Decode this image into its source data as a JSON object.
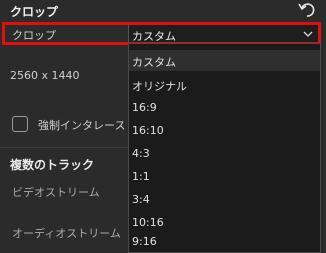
{
  "panel_title": "クロップ",
  "icons": {
    "undo": "undo-icon",
    "chevron": "chevron-down-icon"
  },
  "crop": {
    "label": "クロップ",
    "selected": "カスタム",
    "options": [
      "カスタム",
      "オリジナル",
      "16:9",
      "16:10",
      "4:3",
      "1:1",
      "3:4",
      "10:16",
      "9:16"
    ]
  },
  "resolution": "2560 x 1440",
  "deinterlace_label": "強制インタレース",
  "multi_track": {
    "title": "複数のトラック",
    "video_label": "ビデオストリーム",
    "audio_label": "オーディオストリーム"
  },
  "colors": {
    "highlight": "#e01010",
    "background": "#2b2b2b",
    "dropdown": "#1b1b1b"
  }
}
